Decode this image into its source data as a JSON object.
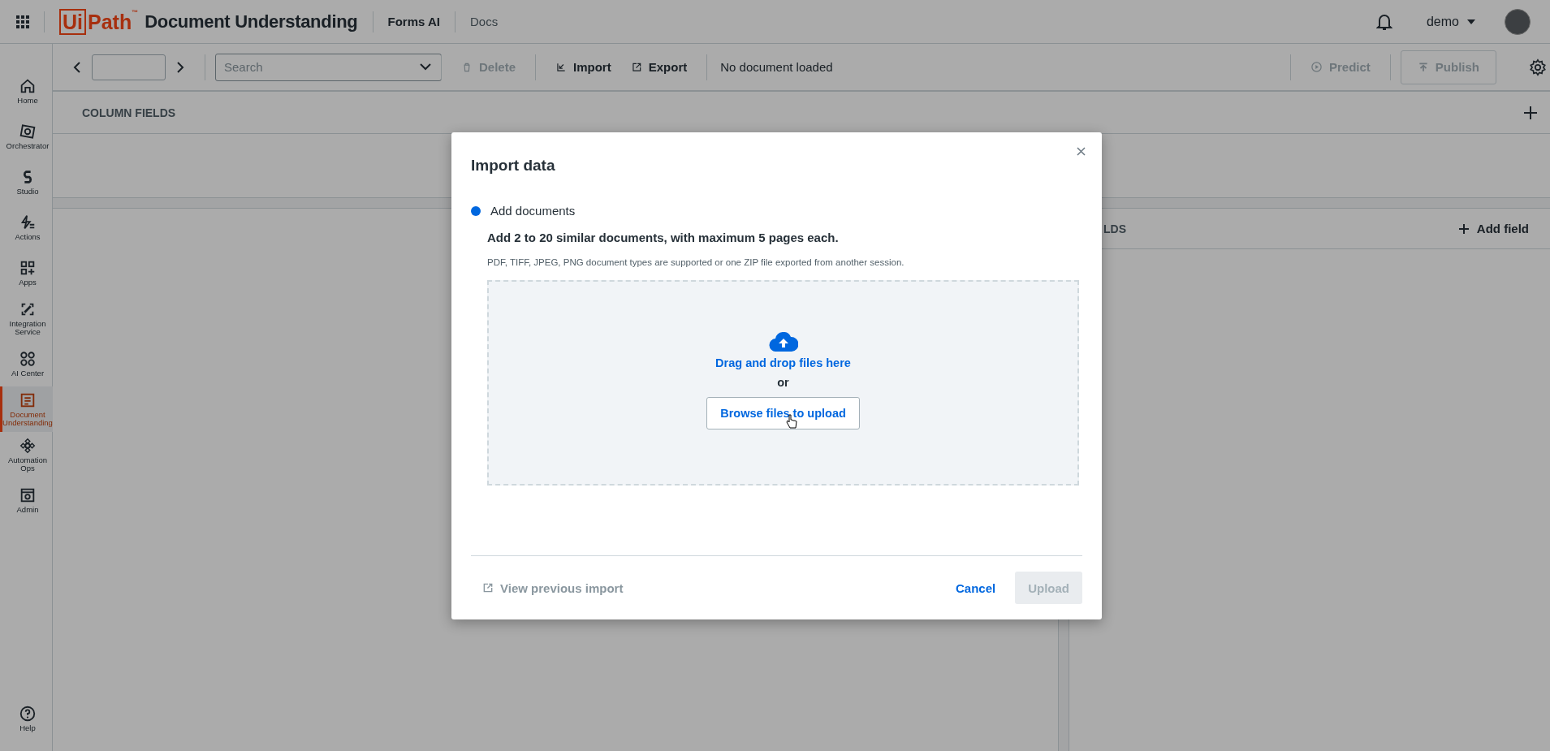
{
  "header": {
    "logo": {
      "boxed": "Ui",
      "text": "Path",
      "trademark": "™"
    },
    "product": "Document Understanding",
    "nav": [
      {
        "label": "Forms AI",
        "selected": true
      },
      {
        "label": "Docs",
        "selected": false
      }
    ],
    "user": "demo"
  },
  "sidebar": {
    "items": [
      {
        "label": "Home",
        "selected": false
      },
      {
        "label": "Orchestrator",
        "selected": false
      },
      {
        "label": "Studio",
        "selected": false
      },
      {
        "label": "Actions",
        "selected": false
      },
      {
        "label": "Apps",
        "selected": false
      },
      {
        "label": "Integration Service",
        "selected": false
      },
      {
        "label": "AI Center",
        "selected": false
      },
      {
        "label": "Document Understanding",
        "selected": true
      },
      {
        "label": "Automation Ops",
        "selected": false
      },
      {
        "label": "Admin",
        "selected": false
      }
    ],
    "help": "Help"
  },
  "toolbar": {
    "search": {
      "placeholder": "Search"
    },
    "actions": [
      {
        "label": "Delete",
        "disabled": true
      },
      {
        "label": "Import",
        "disabled": false
      },
      {
        "label": "Export",
        "disabled": false
      }
    ],
    "status": "No document loaded",
    "predict": {
      "label": "Predict",
      "disabled": true
    },
    "publish": {
      "label": "Publish",
      "disabled": true
    }
  },
  "column_fields": {
    "title": "COLUMN FIELDS"
  },
  "fields_panel": {
    "title": "LDS",
    "add_label": "Add field"
  },
  "dialog": {
    "title": "Import data",
    "step": {
      "label": "Add documents",
      "active": true
    },
    "heading": "Add 2 to 20 similar documents, with maximum 5 pages each.",
    "note": "PDF, TIFF, JPEG, PNG document types are supported or one ZIP file exported from another session.",
    "dropzone": {
      "drag_text": "Drag and drop files here",
      "or_text": "or",
      "browse_label": "Browse files to upload"
    },
    "view_previous": "View previous import",
    "cancel": "Cancel",
    "upload": {
      "label": "Upload",
      "disabled": true
    }
  }
}
